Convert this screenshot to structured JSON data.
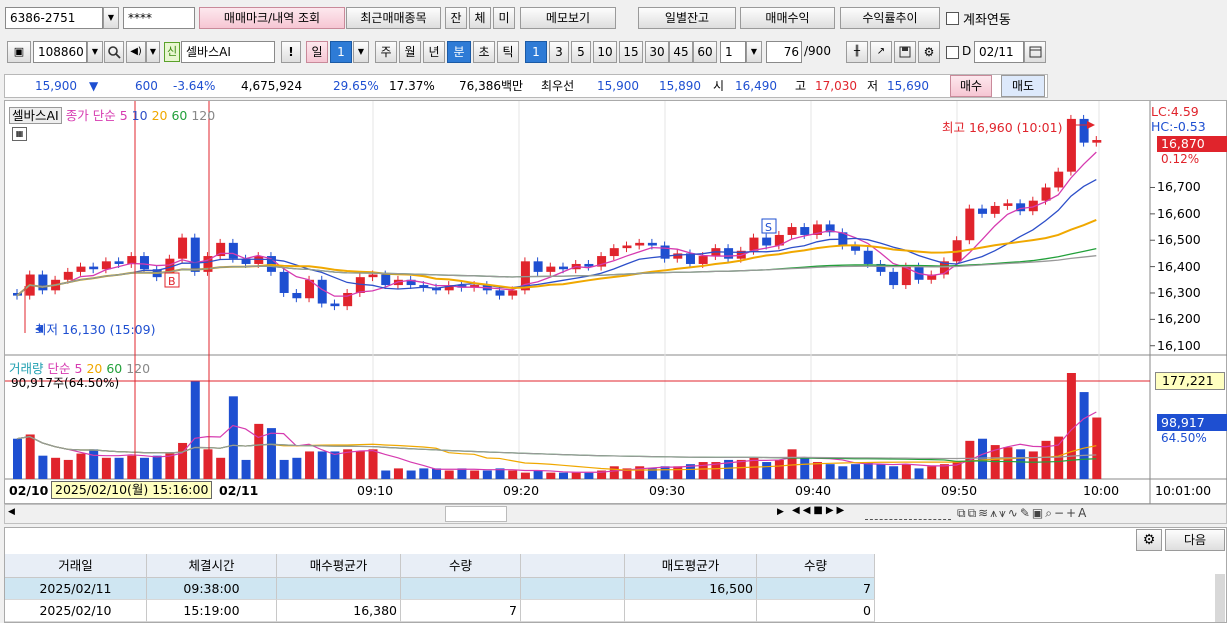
{
  "row1": {
    "account": "6386-2751",
    "password": "****",
    "btn_trade_marks": "매매마크/내역 조회",
    "btn_recent": "최근매매종목",
    "btn_jan": "잔",
    "btn_che": "체",
    "btn_mi": "미",
    "btn_memo": "메모보기",
    "btn_daily_balance": "일별잔고",
    "btn_trade_profit": "매매수익",
    "btn_yield_trend": "수익률추이",
    "account_link_label": "계좌연동"
  },
  "row2": {
    "stock_code": "108860",
    "sin_badge": "신",
    "stock_name": "셀바스AI",
    "exclaim": "!",
    "period_buttons": [
      "일",
      "1",
      "주",
      "월",
      "년",
      "분",
      "초",
      "틱"
    ],
    "minute_buttons": [
      "1",
      "3",
      "5",
      "10",
      "15",
      "30",
      "45",
      "60"
    ],
    "unit_value": "1",
    "count_current": "76",
    "count_total": "/900",
    "d_label": "D",
    "date_value": "02/11"
  },
  "quote": {
    "price": "15,900",
    "change_arrow": "▼",
    "change": "600",
    "change_pct": "-3.64%",
    "volume": "4,675,924",
    "pct1": "29.65%",
    "pct2": "17.37%",
    "amount": "76,386백만",
    "best_label": "최우선",
    "best_ask": "15,900",
    "best_bid": "15,890",
    "open_label": "시",
    "open": "16,490",
    "high_label": "고",
    "high": "17,030",
    "low_label": "저",
    "low": "15,690",
    "buy_label": "매수",
    "sell_label": "매도"
  },
  "price_panel": {
    "legend_name": "셀바스AI",
    "legend_close": "종가",
    "legend_ma": "단순",
    "ma_periods": [
      "5",
      "10",
      "20",
      "60",
      "120"
    ],
    "max_label": "최고 16,960 (10:01)",
    "min_label": "최저 16,130 (15:09)",
    "lc": "LC:4.59",
    "hc": "HC:-0.53",
    "last_price": "16,870",
    "last_pct": "0.12%",
    "y_ticks": [
      "16,700",
      "16,600",
      "16,500",
      "16,400",
      "16,300",
      "16,200",
      "16,100"
    ],
    "b_marker": "B",
    "s_marker": "S"
  },
  "volume_panel": {
    "legend_name": "거래량",
    "legend_ma": "단순",
    "ma_periods": [
      "5",
      "20",
      "60",
      "120"
    ],
    "ref_label": "90,917주(64.50%)",
    "ref_value": "177,221",
    "last_volume": "98,917",
    "last_pct": "64.50%"
  },
  "xaxis": {
    "labels": [
      "02/10",
      "02/11",
      "09:10",
      "09:20",
      "09:30",
      "09:40",
      "09:50",
      "10:00"
    ],
    "cursor_tooltip": "2025/02/10(월) 15:16:00",
    "right_time": "10:01:00"
  },
  "colors": {
    "up": "#e0242c",
    "down": "#1e4fd1",
    "ma5": "#d63bb0",
    "ma10": "#2d4fc9",
    "ma20": "#f0a800",
    "ma60": "#22a03a",
    "ma120": "#999999"
  },
  "chart_data": {
    "type": "candlestick",
    "interval": "1 minute",
    "y_range": [
      16080,
      16990
    ],
    "high": {
      "value": 16960,
      "time": "10:01"
    },
    "low": {
      "value": 16130,
      "time": "15:09"
    },
    "last": 16870,
    "volume_reference": 177221,
    "last_volume": 98917
  },
  "grid": {
    "next_button": "다음",
    "headers": [
      "거래일",
      "체결시간",
      "매수평균가",
      "수량",
      "",
      "매도평균가",
      "수량"
    ],
    "rows": [
      [
        "2025/02/11",
        "09:38:00",
        "",
        "",
        "",
        "16,500",
        "7"
      ],
      [
        "2025/02/10",
        "15:19:00",
        "16,380",
        "7",
        "",
        "",
        "0"
      ]
    ]
  }
}
